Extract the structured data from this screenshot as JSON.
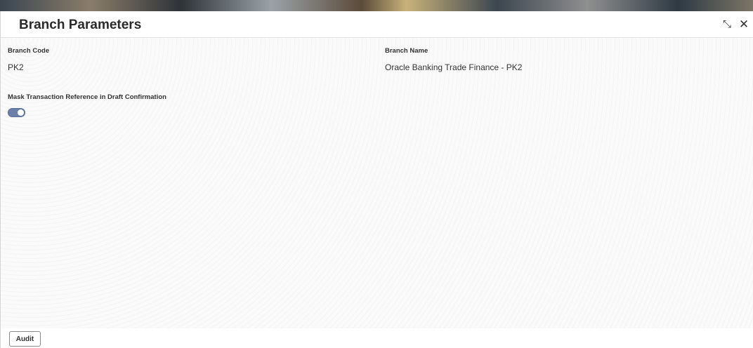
{
  "header": {
    "title": "Branch Parameters",
    "collapse_icon": "collapse-arrows-icon",
    "close_icon": "close-icon",
    "collapse_glyph": "⤡",
    "close_glyph": "✕"
  },
  "fields": {
    "branch_code_label": "Branch Code",
    "branch_code_value": "PK2",
    "branch_name_label": "Branch Name",
    "branch_name_value": "Oracle Banking Trade Finance - PK2",
    "mask_label": "Mask Transaction Reference in Draft Confirmation",
    "mask_enabled": true
  },
  "footer": {
    "audit_label": "Audit"
  },
  "colors": {
    "toggle_on": "#6b7fa8"
  }
}
